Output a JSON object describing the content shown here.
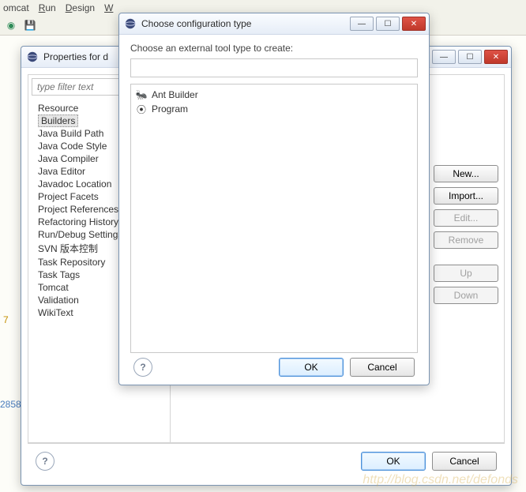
{
  "ide": {
    "menu": [
      {
        "pre": "",
        "accel": "",
        "post": "omcat"
      },
      {
        "pre": "",
        "accel": "R",
        "post": "un"
      },
      {
        "pre": "",
        "accel": "D",
        "post": "esign"
      },
      {
        "pre": "",
        "accel": "W",
        "post": ""
      }
    ],
    "gutter_number": "2858",
    "line_number": "7"
  },
  "properties_window": {
    "title": "Properties for d",
    "filter_placeholder": "type filter text",
    "tree": [
      "Resource",
      "Builders",
      "Java Build Path",
      "Java Code Style",
      "Java Compiler",
      "Java Editor",
      "Javadoc Location",
      "Project Facets",
      "Project References",
      "Refactoring History",
      "Run/Debug Settings",
      "SVN 版本控制",
      "Task Repository",
      "Task Tags",
      "Tomcat",
      "Validation",
      "WikiText"
    ],
    "tree_selected_index": 1,
    "buttons": {
      "new": "New...",
      "import": "Import...",
      "edit": "Edit...",
      "remove": "Remove",
      "up": "Up",
      "down": "Down"
    },
    "footer": {
      "ok": "OK",
      "cancel": "Cancel"
    }
  },
  "choose_dialog": {
    "title": "Choose configuration type",
    "prompt": "Choose an external tool type to create:",
    "input_value": "",
    "options": [
      {
        "icon": "ant-icon",
        "glyph": "🐜",
        "label": "Ant Builder"
      },
      {
        "icon": "program-icon",
        "glyph": "⦿",
        "label": "Program"
      }
    ],
    "footer": {
      "ok": "OK",
      "cancel": "Cancel"
    }
  },
  "watermark": "http://blog.csdn.net/defonds"
}
